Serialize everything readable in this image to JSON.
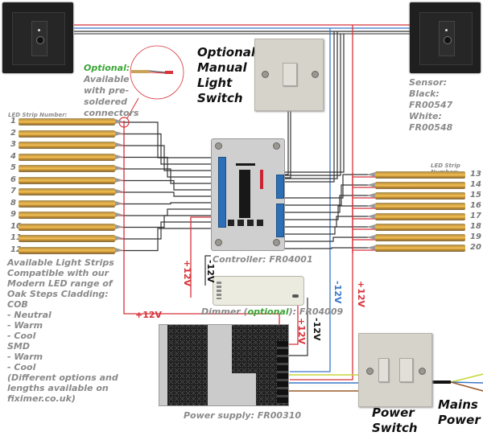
{
  "title_labels": {
    "optional_switch": [
      "Optional",
      "Manual",
      "Light",
      "Switch"
    ],
    "power_switch": [
      "Power",
      "Switch"
    ],
    "mains_power": [
      "Mains",
      "Power"
    ]
  },
  "optional_connector_note": {
    "highlight": "Optional:",
    "lines": [
      "Available",
      "with pre-",
      "soldered",
      "connectors"
    ]
  },
  "sensor": {
    "heading": "Sensor:",
    "black": "Black: FR00547",
    "white": "White: FR00548"
  },
  "led_strips": {
    "left_heading": "LED Strip Number:",
    "right_heading": "LED Strip Number:",
    "left_numbers": [
      "1",
      "2",
      "3",
      "4",
      "5",
      "6",
      "7",
      "8",
      "9",
      "10",
      "11",
      "12"
    ],
    "right_numbers": [
      "13",
      "14",
      "15",
      "16",
      "17",
      "18",
      "19",
      "20"
    ]
  },
  "controller": {
    "label": "Controller: FR04001"
  },
  "dimmer": {
    "prefix": "Dimmer (",
    "optional": "optional",
    "suffix": "): FR04009"
  },
  "power_supply": {
    "label": "Power supply:   FR00310"
  },
  "voltages": {
    "pos_main": "+12V",
    "pos_dimmer_in": "+12V",
    "neg_dimmer_in": "-12V",
    "pos_psu": "+12V",
    "neg_psu": "-12V",
    "neg_blue": "-12V",
    "pos_red": "+12V"
  },
  "available_strips": {
    "lines": [
      "Available Light Strips",
      "Compatible with our",
      "Modern LED range of",
      "Oak Steps Cladding:",
      "COB",
      "- Neutral",
      "- Warm",
      "- Cool",
      "SMD",
      "- Warm",
      "- Cool",
      "(Different options and",
      "lengths available on",
      "fiximer.co.uk)"
    ]
  },
  "colors": {
    "positive_wire": "#d8333a",
    "negative_wire": "#3b78c9",
    "signal_wire": "#333333",
    "earth_wire": "#c8d63a",
    "live_wire": "#9a5a2a",
    "optional_green": "#3aa536"
  }
}
